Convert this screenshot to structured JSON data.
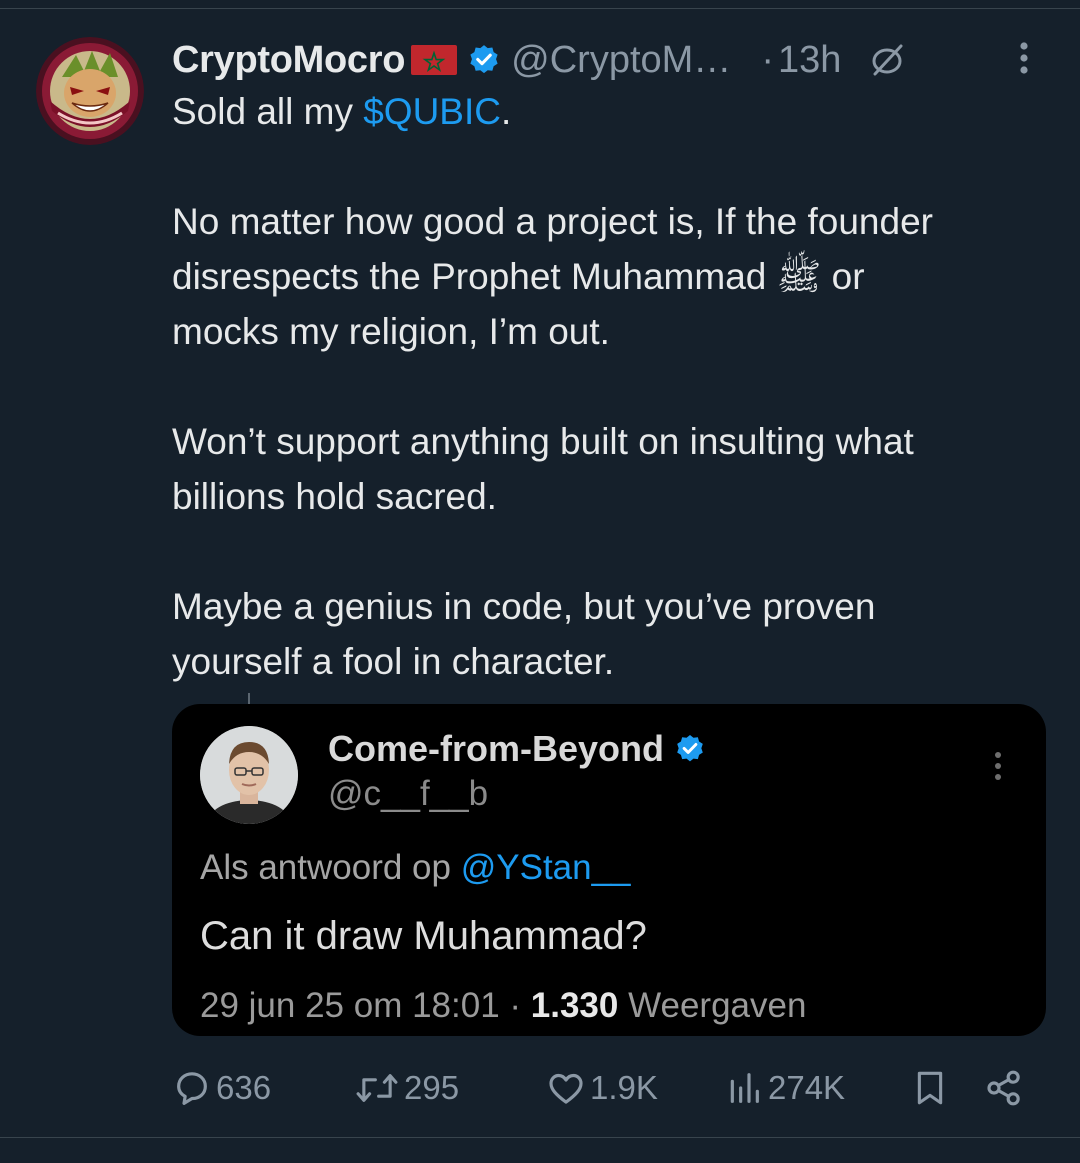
{
  "tweet": {
    "author": {
      "display_name": "CryptoMocro",
      "handle": "@CryptoM…",
      "verified": true,
      "flag": "morocco-flag"
    },
    "time_sep": "·",
    "time": "13h",
    "body": {
      "line1_prefix": "Sold all my ",
      "cashtag": "$QUBIC",
      "line1_suffix": ".",
      "para2_line1": "No matter how good a project is, If the founder",
      "para2_line2": "disrespects the Prophet Muhammad ﷺ or",
      "para2_line3": "mocks my religion, I’m out.",
      "para3_line1": "Won’t support anything built on insulting what",
      "para3_line2": "billions hold sacred.",
      "para4_line1": "Maybe a genius in code, but you’ve proven",
      "para4_line2": "yourself a fool in character."
    },
    "quoted": {
      "display_name": "Come-from-Beyond",
      "handle": "@c__f__b",
      "verified": true,
      "reply_prefix": "Als antwoord op ",
      "reply_mention": "@YStan__",
      "text": "Can it draw Muhammad?",
      "date": "29 jun 25 om 18:01",
      "meta_sep": " · ",
      "views_count": "1.330",
      "views_label": " Weergaven"
    },
    "actions": {
      "replies": "636",
      "reposts": "295",
      "likes": "1.9K",
      "views": "274K"
    }
  },
  "colors": {
    "background": "#15202b",
    "accent": "#1d9bf0",
    "muted": "#8b98a5",
    "text": "#e7e9ea"
  },
  "icons": [
    "avatar",
    "morocco-flag",
    "verified-badge-icon",
    "grok-icon",
    "more-icon",
    "reply-icon",
    "repost-icon",
    "like-icon",
    "views-icon",
    "bookmark-icon",
    "share-icon"
  ]
}
